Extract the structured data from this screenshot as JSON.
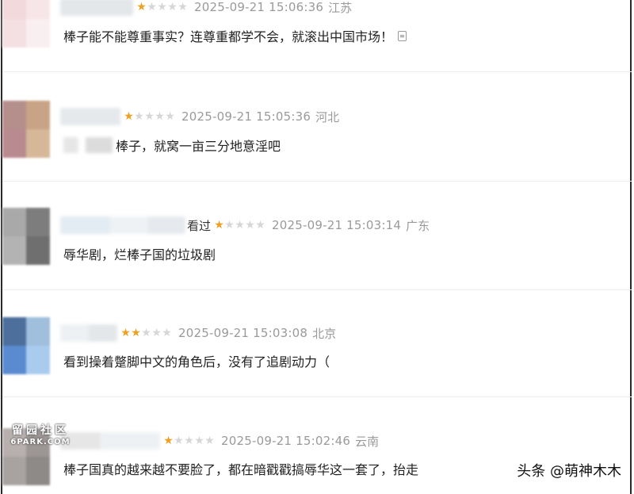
{
  "comments": [
    {
      "read_label": "",
      "stars_filled": 1,
      "stars_total": 5,
      "time": "2025-09-21 15:06:36",
      "location": "江苏",
      "text_blur_prefix": false,
      "text": "棒子能不能尊重事实？连尊重都学不会，就滚出中国市场！",
      "avatar_colors": [
        "#f2d9dc",
        "#f7e6e8",
        "#f4dfe2",
        "#f9eef0"
      ]
    },
    {
      "read_label": "",
      "stars_filled": 1,
      "stars_total": 5,
      "time": "2025-09-21 15:05:36",
      "location": "河北",
      "text_blur_prefix": true,
      "text": "棒子，就窝一亩三分地意淫吧",
      "avatar_colors": [
        "#b48f8c",
        "#c9a385",
        "#b98b91",
        "#d6b898"
      ]
    },
    {
      "read_label": "看过",
      "stars_filled": 1,
      "stars_total": 5,
      "time": "2025-09-21 15:03:14",
      "location": "广东",
      "text_blur_prefix": false,
      "text": "辱华剧，烂棒子国的垃圾剧",
      "avatar_colors": [
        "#a9a9a9",
        "#7d7d7d",
        "#b3b3b3",
        "#6f6f6f"
      ]
    },
    {
      "read_label": "",
      "stars_filled": 2,
      "stars_total": 5,
      "time": "2025-09-21 15:03:08",
      "location": "北京",
      "text_blur_prefix": false,
      "text": "看到操着蹩脚中文的角色后，没有了追剧动力（",
      "avatar_colors": [
        "#4d6f9c",
        "#9fbfdc",
        "#5a8bd0",
        "#a9ccee"
      ]
    },
    {
      "read_label": "",
      "stars_filled": 1,
      "stars_total": 5,
      "time": "2025-09-21 15:02:46",
      "location": "云南",
      "text_blur_prefix": false,
      "text": "棒子国真的越来越不要脸了，都在暗戳戳搞辱华这一套了，抬走",
      "avatar_colors": [
        "#b8b0ae",
        "#9c9694",
        "#a8a3a1",
        "#8d8a88"
      ]
    }
  ],
  "watermark_left": {
    "chinese": "留园社区",
    "english": "6PARK.COM"
  },
  "watermark_right": "头条 @萌神木木",
  "star_glyph": "★",
  "icons": {
    "report": "report-icon"
  }
}
